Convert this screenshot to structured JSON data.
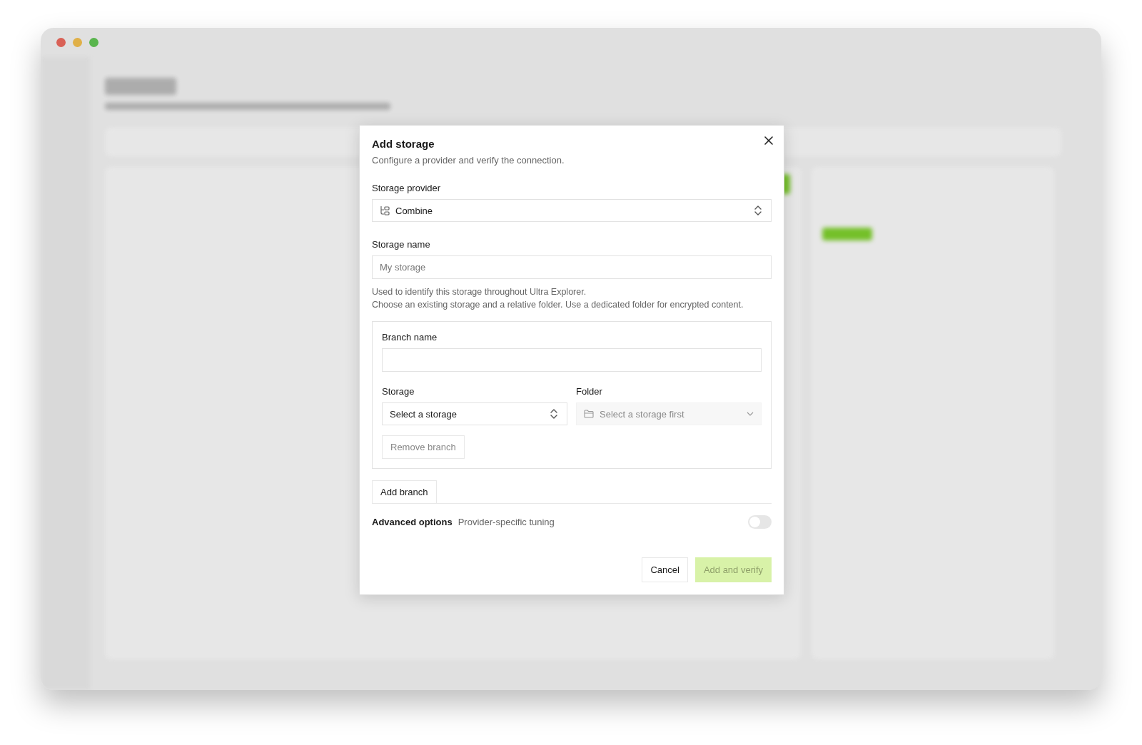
{
  "dialog": {
    "title": "Add storage",
    "subtitle": "Configure a provider and verify the connection."
  },
  "provider": {
    "label": "Storage provider",
    "value": "Combine"
  },
  "storage_name": {
    "label": "Storage name",
    "placeholder": "My storage",
    "help": [
      "Used to identify this storage throughout Ultra Explorer.",
      "Choose an existing storage and a relative folder. Use a dedicated folder for encrypted content."
    ]
  },
  "branches": [
    {
      "name_label": "Branch name",
      "storage_label": "Storage",
      "storage_value": "Select a storage",
      "folder_label": "Folder",
      "folder_placeholder": "Select a storage first",
      "folder_disabled": true,
      "remove_label": "Remove branch",
      "remove_disabled": true
    }
  ],
  "add_branch": "Add branch",
  "advanced": {
    "label": "Advanced options",
    "hint": "Provider-specific tuning",
    "on": false
  },
  "buttons": [
    {
      "label": "Cancel",
      "kind": "secondary",
      "disabled": false
    },
    {
      "label": "Add and verify",
      "kind": "primary",
      "disabled": true
    }
  ]
}
